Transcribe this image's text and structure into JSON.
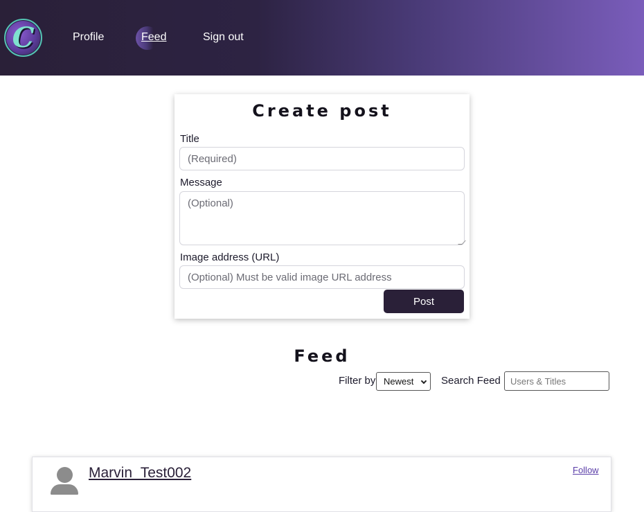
{
  "header": {
    "logo_letter": "C",
    "nav": {
      "profile": "Profile",
      "feed": "Feed",
      "sign_out": "Sign out"
    },
    "active_nav": "Feed"
  },
  "create_post": {
    "heading": "Create post",
    "title_label": "Title",
    "title_placeholder": "(Required)",
    "title_value": "",
    "message_label": "Message",
    "message_placeholder": "(Optional)",
    "message_value": "",
    "image_label": "Image address (URL)",
    "image_placeholder": "(Optional) Must be valid image URL address",
    "image_value": "",
    "post_button": "Post"
  },
  "feed": {
    "heading": "Feed",
    "filter_label": "Filter by",
    "filter_selected": "Newest",
    "search_label": "Search Feed",
    "search_placeholder": "Users & Titles"
  },
  "posts": [
    {
      "username": "Marvin_Test002",
      "follow_label": "Follow"
    }
  ],
  "colors": {
    "header_dark": "#2a2038",
    "header_light": "#7a5dbb",
    "button": "#2a2038",
    "accent_teal": "#54c4b4",
    "link": "#5a3da8"
  }
}
